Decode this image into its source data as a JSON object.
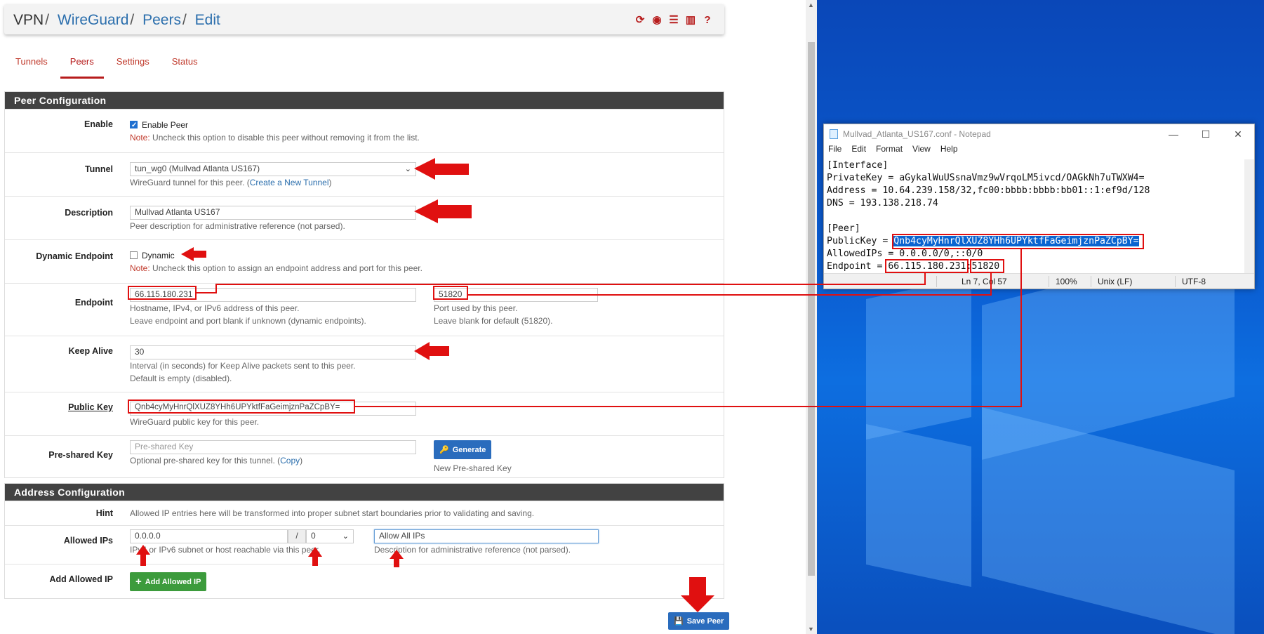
{
  "breadcrumb": {
    "root": "VPN",
    "sep": "/",
    "items": [
      "WireGuard",
      "Peers",
      "Edit"
    ]
  },
  "tabs": [
    "Tunnels",
    "Peers",
    "Settings",
    "Status"
  ],
  "peer_config": {
    "heading": "Peer Configuration",
    "enable": {
      "label": "Enable",
      "checkbox_label": "Enable Peer",
      "checked": true,
      "note_prefix": "Note:",
      "note": " Uncheck this option to disable this peer without removing it from the list."
    },
    "tunnel": {
      "label": "Tunnel",
      "value": "tun_wg0 (Mullvad Atlanta US167)",
      "help": "WireGuard tunnel for this peer. (",
      "link": "Create a New Tunnel",
      "help_end": ")"
    },
    "description": {
      "label": "Description",
      "value": "Mullvad Atlanta US167",
      "help": "Peer description for administrative reference (not parsed)."
    },
    "dynamic": {
      "label": "Dynamic Endpoint",
      "checkbox_label": "Dynamic",
      "checked": false,
      "note_prefix": "Note:",
      "note": " Uncheck this option to assign an endpoint address and port for this peer."
    },
    "endpoint": {
      "label": "Endpoint",
      "value": "66.115.180.231",
      "help1": "Hostname, IPv4, or IPv6 address of this peer.",
      "help2": "Leave endpoint and port blank if unknown (dynamic endpoints).",
      "port": "51820",
      "port_help1": "Port used by this peer.",
      "port_help2": "Leave blank for default (51820)."
    },
    "keepalive": {
      "label": "Keep Alive",
      "value": "30",
      "help1": "Interval (in seconds) for Keep Alive packets sent to this peer.",
      "help2": "Default is empty (disabled)."
    },
    "pubkey": {
      "label": "Public Key",
      "value": "Qnb4cyMyHnrQlXUZ8YHh6UPYktfFaGeimjznPaZCpBY=",
      "help": "WireGuard public key for this peer."
    },
    "psk": {
      "label": "Pre-shared Key",
      "placeholder": "Pre-shared Key",
      "help": "Optional pre-shared key for this tunnel. (",
      "link": "Copy",
      "help_end": ")",
      "generate": "Generate",
      "generate_help": "New Pre-shared Key"
    }
  },
  "address_config": {
    "heading": "Address Configuration",
    "hint": {
      "label": "Hint",
      "text": "Allowed IP entries here will be transformed into proper subnet start boundaries prior to validating and saving."
    },
    "allowed": {
      "label": "Allowed IPs",
      "ip": "0.0.0.0",
      "slash": "/",
      "mask": "0",
      "desc": "Allow All IPs",
      "help_ip": "IPv4 or IPv6 subnet or host reachable via this peer.",
      "help_desc": "Description for administrative reference (not parsed)."
    },
    "add": {
      "label": "Add Allowed IP",
      "button": "Add Allowed IP"
    }
  },
  "save_button": "Save Peer",
  "notepad": {
    "title": "Mullvad_Atlanta_US167.conf - Notepad",
    "menu": [
      "File",
      "Edit",
      "Format",
      "View",
      "Help"
    ],
    "lines": [
      "[Interface]",
      "PrivateKey = aGykalWuUSsnaVmz9wVrqoLM5ivcd/OAGkNh7uTWXW4=",
      "Address = 10.64.239.158/32,fc00:bbbb:bbbb:bb01::1:ef9d/128",
      "DNS = 193.138.218.74",
      "",
      "[Peer]"
    ],
    "pubkey_prefix": "PublicKey = ",
    "pubkey_value": "Qnb4cyMyHnrQlXUZ8YHh6UPYktfFaGeimjznPaZCpBY=",
    "allowed_line": "AllowedIPs = 0.0.0.0/0,::0/0",
    "endpoint_prefix": "Endpoint = ",
    "endpoint_host": "66.115.180.231",
    "endpoint_colon": ":",
    "endpoint_port": "51820",
    "status": {
      "position": "Ln 7, Col 57",
      "zoom": "100%",
      "eol": "Unix (LF)",
      "encoding": "UTF-8"
    }
  },
  "colors": {
    "accent_red": "#b71c1c",
    "annotation_red": "#e01010",
    "link_blue": "#2c6fad",
    "header_dark": "#424242",
    "desktop_blue": "#0b5fd3"
  }
}
